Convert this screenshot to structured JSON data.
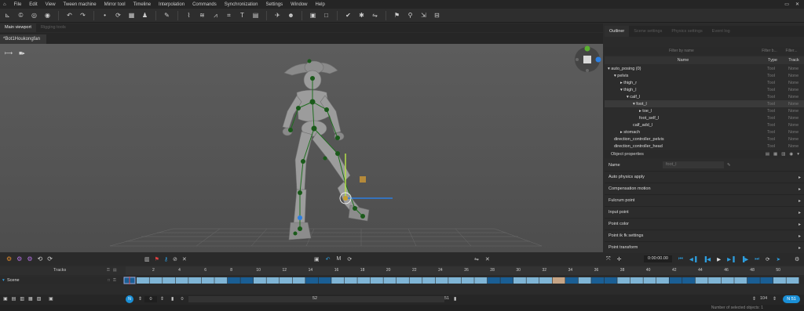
{
  "menubar": {
    "items": [
      "File",
      "Edit",
      "View",
      "Tween machine",
      "Mirror tool",
      "Timeline",
      "Interpolation",
      "Commands",
      "Synchronization",
      "Settings",
      "Window",
      "Help"
    ]
  },
  "viewport_tabs": {
    "main": "Main viewport",
    "rigging": "Rigging tools"
  },
  "doc_tab": "*Bot1Houkongfan",
  "right_tabs": [
    "Outliner",
    "Scene settings",
    "Physics settings",
    "Event log"
  ],
  "outliner": {
    "filter_placeholder": "Filter by name",
    "filter2_placeholder": "Filter b...",
    "filter3_placeholder": "Filter...",
    "col_name": "Name",
    "col_type": "Type",
    "col_track": "Track",
    "rows": [
      {
        "name": "auto_posing (0)",
        "type": "Tool",
        "track": "None",
        "indent": 0,
        "arrow": "▾"
      },
      {
        "name": "pelvis",
        "type": "Tool",
        "track": "None",
        "indent": 1,
        "arrow": "▾"
      },
      {
        "name": "thigh_r",
        "type": "Tool",
        "track": "None",
        "indent": 2,
        "arrow": "▸"
      },
      {
        "name": "thigh_l",
        "type": "Tool",
        "track": "None",
        "indent": 2,
        "arrow": "▾"
      },
      {
        "name": "calf_l",
        "type": "Tool",
        "track": "None",
        "indent": 3,
        "arrow": "▾"
      },
      {
        "name": "foot_l",
        "type": "Tool",
        "track": "None",
        "indent": 4,
        "arrow": "▾",
        "selected": true
      },
      {
        "name": "toe_l",
        "type": "Tool",
        "track": "None",
        "indent": 5,
        "arrow": "▸"
      },
      {
        "name": "foot_self_l",
        "type": "Tool",
        "track": "None",
        "indent": 5,
        "arrow": ""
      },
      {
        "name": "calf_add_l",
        "type": "Tool",
        "track": "None",
        "indent": 4,
        "arrow": ""
      },
      {
        "name": "stomach",
        "type": "Tool",
        "track": "None",
        "indent": 2,
        "arrow": "▸"
      },
      {
        "name": "direction_controller_pelvis",
        "type": "Tool",
        "track": "None",
        "indent": 1,
        "arrow": ""
      },
      {
        "name": "direction_controller_head",
        "type": "Tool",
        "track": "None",
        "indent": 1,
        "arrow": ""
      }
    ]
  },
  "properties": {
    "title": "Object properties",
    "name_label": "Name",
    "name_value": "foot_l",
    "sections": [
      "Auto physics apply",
      "Compensation motion",
      "Fulcrum point",
      "Input point",
      "Point color",
      "Point ik fk settings",
      "Point transform"
    ]
  },
  "timeline": {
    "tracks_label": "Tracks",
    "scene_label": "Scene",
    "time": "0:00:00.00",
    "ticks": [
      "2",
      "4",
      "6",
      "8",
      "10",
      "12",
      "14",
      "16",
      "18",
      "20",
      "22",
      "24",
      "26",
      "28",
      "30",
      "32",
      "34",
      "36",
      "38",
      "40",
      "42",
      "44",
      "46",
      "48",
      "50"
    ],
    "frame_start": "0",
    "frame_cur": "0",
    "range_mid": "52",
    "range_end": "51",
    "total_frames": "104",
    "fps_badge": "51",
    "status": "Number of selected objects: 1"
  },
  "colors": {
    "accent_blue": "#1a8fd6",
    "key_light": "#7fb5d6",
    "key_dark": "#1a5e94",
    "key_tan": "#c6a586",
    "playhead": "#e04040"
  }
}
